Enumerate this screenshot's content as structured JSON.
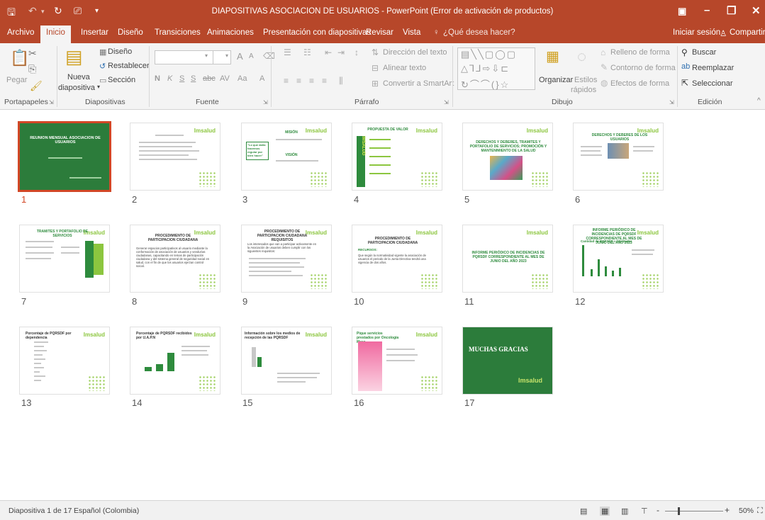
{
  "titlebar": {
    "save_icon": "save-icon",
    "title": "DIAPOSITIVAS ASOCIACION DE USUARIOS - PowerPoint (Error de activación de productos)"
  },
  "tabs": {
    "archivo": "Archivo",
    "inicio": "Inicio",
    "insertar": "Insertar",
    "diseno": "Diseño",
    "transiciones": "Transiciones",
    "animaciones": "Animaciones",
    "presentacion": "Presentación con diapositivas",
    "revisar": "Revisar",
    "vista": "Vista",
    "tell_me": "¿Qué desea hacer?",
    "signin": "Iniciar sesión",
    "share": "Compartir"
  },
  "ribbon": {
    "portapapeles": {
      "label": "Portapapeles",
      "pegar": "Pegar"
    },
    "diapositivas": {
      "label": "Diapositivas",
      "nueva1": "Nueva",
      "nueva2": "diapositiva",
      "diseno": "Diseño",
      "restablecer": "Restablecer",
      "seccion": "Sección"
    },
    "fuente": {
      "label": "Fuente",
      "bold": "N",
      "italic": "K",
      "underline": "S",
      "strike": "S",
      "abc": "abc",
      "spacing": "AV",
      "case": "Aa",
      "color": "A",
      "grow": "A",
      "shrink": "A"
    },
    "parrafo": {
      "label": "Párrafo",
      "direccion": "Dirección del texto",
      "alinear": "Alinear texto",
      "smartart": "Convertir a SmartArt"
    },
    "dibujo": {
      "label": "Dibujo",
      "organizar": "Organizar",
      "estilos1": "Estilos",
      "estilos2": "rápidos",
      "relleno": "Relleno de forma",
      "contorno": "Contorno de forma",
      "efectos": "Efectos de forma"
    },
    "edicion": {
      "label": "Edición",
      "buscar": "Buscar",
      "reemplazar": "Reemplazar",
      "seleccionar": "Seleccionar"
    }
  },
  "slides": [
    {
      "num": "1",
      "title": "REUNION MENSUAL ASOCIACION DE USUARIOS"
    },
    {
      "num": "2",
      "title": ""
    },
    {
      "num": "3",
      "title": "MISIÓN",
      "quote": "\"Lo que daña hacemos regular por bien hacer\"",
      "sub": "VISIÓN"
    },
    {
      "num": "4",
      "title": "PROPUESTA DE VALOR",
      "side": "IMSALUD"
    },
    {
      "num": "5",
      "title": "DERECHOS Y DEBERES, TRAMITES Y PORTAFOLIO DE SERVICIOS; PROMOCIÓN Y MANTENIMIENTO DE LA SALUD"
    },
    {
      "num": "6",
      "title": "DERECHOS Y DEBERES DE LOS USUARIOS"
    },
    {
      "num": "7",
      "title": "TRAMITES Y PORTAFOLIO DE SERVICIOS"
    },
    {
      "num": "8",
      "title": "PROCEDIMIENTO DE PARTICIPACION CIUDADANA",
      "body": "Generar espacios participativos al usuario mediante la conformación de asociación de usuarios y veedurías ciudadanas, capacitando en temas de participación ciudadana y del sistema general de seguridad social en salud, con el fin de que los usuarios ejerzan control social."
    },
    {
      "num": "9",
      "title": "PROCEDIMIENTO DE PARTICIPACION CIUDADANA REQUISITOS",
      "body": "Los interesados que van a participar activamente en la Asociación de usuarios deben cumplir con los siguientes requisitos:"
    },
    {
      "num": "10",
      "title": "PROCEDIMIENTO DE PARTICIPACION CIUDADANA",
      "sub": "RECURSOS:",
      "body": "Que según la normatividad vigente la asociación de usuarios el periodo de la Junta Directiva tendrá una vigencia de dos años."
    },
    {
      "num": "11",
      "title": "INFORME PERIÓDICO DE INCIDENCIAS DE PQRSDF CORRESPONDIENTE AL MES DE JUNIO DEL AÑO 2023"
    },
    {
      "num": "12",
      "title": "INFORME PERIÓDICO DE INCIDENCIAS DE PQRSDF CORRESPONDIENTE AL MES DE JUNIO DEL AÑO 2023",
      "sub": "Cantidad de PQRSDF x facilitador"
    },
    {
      "num": "13",
      "title": "Porcentaje de PQRSDF por dependencia"
    },
    {
      "num": "14",
      "title": "Porcentaje de PQRSDF recibidos por U.A.P.N"
    },
    {
      "num": "15",
      "title": "Información sobre los medios de recepción de las PQRSDF"
    },
    {
      "num": "16",
      "title": "Pique servicios prestados por Oncología Mesa"
    },
    {
      "num": "17",
      "title": "MUCHAS GRACIAS",
      "logo": "Imsalud"
    }
  ],
  "logo_text": "Imsalud",
  "statusbar": {
    "slide_info": "Diapositiva 1 de 17",
    "language": "Español (Colombia)",
    "zoom": "50%",
    "zoom_minus": "-",
    "zoom_plus": "+"
  }
}
